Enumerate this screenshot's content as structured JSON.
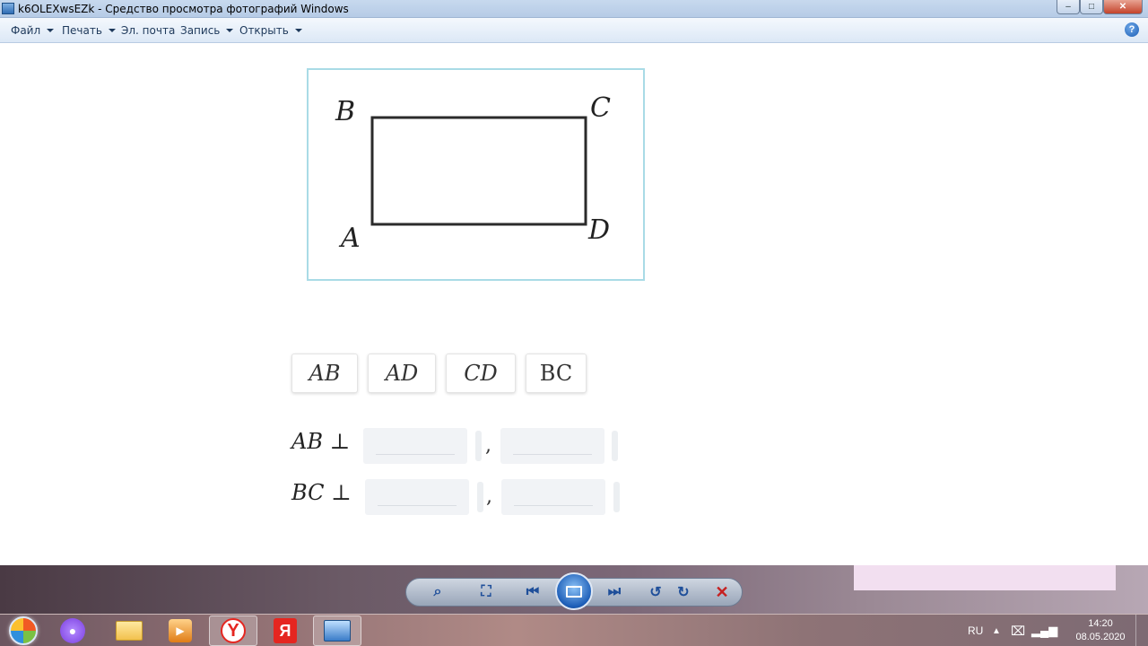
{
  "window": {
    "title": "k6OLEXwsEZk - Средство просмотра фотографий Windows",
    "controls": {
      "minimize": "–",
      "maximize": "□",
      "close": "✕"
    }
  },
  "menu": {
    "items": [
      {
        "label": "Файл",
        "has_dropdown": true
      },
      {
        "label": "Печать",
        "has_dropdown": true
      },
      {
        "label": "Эл. почта",
        "has_dropdown": false
      },
      {
        "label": "Запись",
        "has_dropdown": true
      },
      {
        "label": "Открыть",
        "has_dropdown": true
      }
    ],
    "help": "?"
  },
  "figure": {
    "vertices": {
      "B": "B",
      "C": "C",
      "A": "A",
      "D": "D"
    }
  },
  "answer_chips": [
    "AB",
    "AD",
    "CD",
    "BC"
  ],
  "equations": [
    {
      "segment": "AB",
      "symbol": "⊥",
      "separator": ","
    },
    {
      "segment": "BC",
      "symbol": "⊥",
      "separator": ","
    }
  ],
  "viewer_controls": {
    "icons": [
      "zoom-icon",
      "fit-window-icon",
      "previous-icon",
      "slideshow-icon",
      "next-icon",
      "rotate-left-icon",
      "rotate-right-icon",
      "delete-icon"
    ]
  },
  "taskbar": {
    "apps": [
      "alice",
      "explorer",
      "media-player",
      "yandex-browser",
      "yandex",
      "photo-viewer"
    ],
    "language": "RU",
    "time": "14:20",
    "date": "08.05.2020"
  },
  "colors": {
    "figure_border": "#a9dbe6",
    "close_button": "#c4432b",
    "delete_icon": "#c62020"
  }
}
